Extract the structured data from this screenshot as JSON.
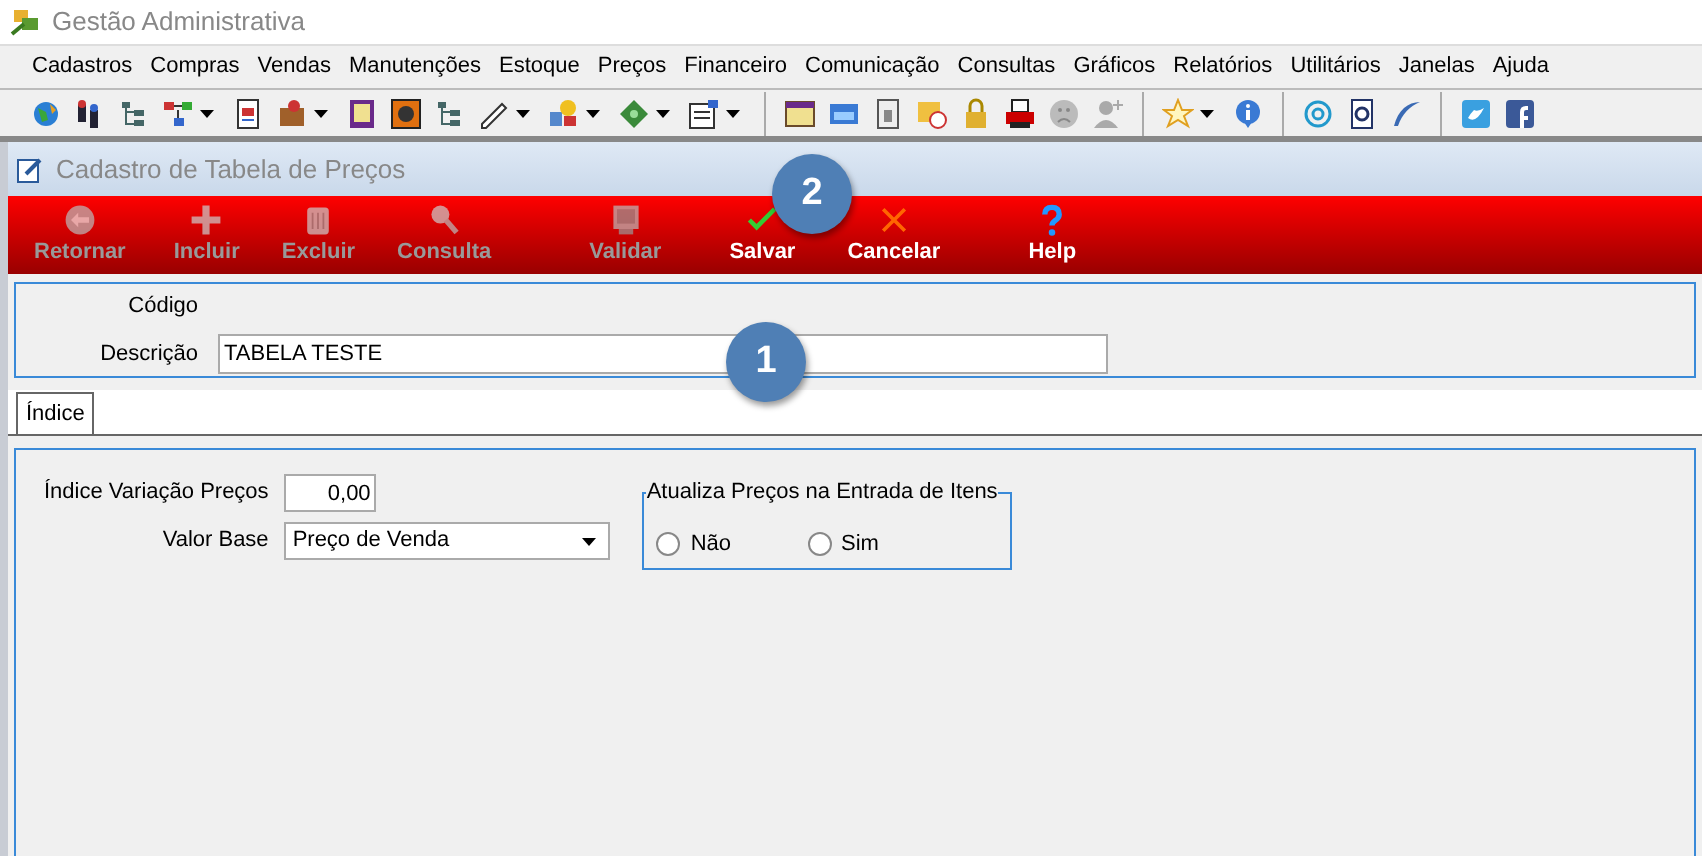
{
  "app_title": "Gestão Administrativa",
  "menu": [
    "Cadastros",
    "Compras",
    "Vendas",
    "Manutenções",
    "Estoque",
    "Preços",
    "Financeiro",
    "Comunicação",
    "Consultas",
    "Gráficos",
    "Relatórios",
    "Utilitários",
    "Janelas",
    "Ajuda"
  ],
  "toolbar": [
    {
      "kind": "button",
      "has_menu": false
    },
    {
      "kind": "button",
      "has_menu": false
    },
    {
      "kind": "button",
      "has_menu": false
    },
    {
      "kind": "button",
      "has_menu": true
    },
    {
      "kind": "button",
      "has_menu": false
    },
    {
      "kind": "button",
      "has_menu": true
    },
    {
      "kind": "button",
      "has_menu": false
    },
    {
      "kind": "button",
      "has_menu": false
    },
    {
      "kind": "button",
      "has_menu": false
    },
    {
      "kind": "button",
      "has_menu": true
    },
    {
      "kind": "button",
      "has_menu": true
    },
    {
      "kind": "button",
      "has_menu": true
    },
    {
      "kind": "button",
      "has_menu": true
    },
    {
      "kind": "separator"
    },
    {
      "kind": "button",
      "has_menu": false
    },
    {
      "kind": "button",
      "has_menu": false
    },
    {
      "kind": "button",
      "has_menu": false
    },
    {
      "kind": "button",
      "has_menu": false
    },
    {
      "kind": "button",
      "has_menu": false
    },
    {
      "kind": "button",
      "has_menu": false
    },
    {
      "kind": "button",
      "has_menu": false
    },
    {
      "kind": "button",
      "has_menu": false
    },
    {
      "kind": "separator"
    },
    {
      "kind": "button",
      "has_menu": true
    },
    {
      "kind": "button",
      "has_menu": false
    },
    {
      "kind": "separator"
    },
    {
      "kind": "button",
      "has_menu": false
    },
    {
      "kind": "button",
      "has_menu": false
    },
    {
      "kind": "button",
      "has_menu": false
    },
    {
      "kind": "separator"
    },
    {
      "kind": "button",
      "has_menu": false
    },
    {
      "kind": "button",
      "has_menu": false
    }
  ],
  "window": {
    "title": "Cadastro de Tabela de Preços"
  },
  "actions": [
    {
      "label": "Retornar",
      "disabled": true
    },
    {
      "label": "Incluir",
      "disabled": true
    },
    {
      "label": "Excluir",
      "disabled": true
    },
    {
      "label": "Consulta",
      "disabled": true
    },
    {
      "label": "Validar",
      "disabled": true
    },
    {
      "label": "Salvar",
      "disabled": false
    },
    {
      "label": "Cancelar",
      "disabled": false
    },
    {
      "label": "Help",
      "disabled": false
    }
  ],
  "header_form": {
    "code_label": "Código",
    "description_label": "Descrição",
    "description_value": "TABELA TESTE"
  },
  "tabs": [
    {
      "label": "Índice",
      "selected": true
    }
  ],
  "index_form": {
    "index_label": "Índice Variação Preços",
    "index_value": "0,00",
    "base_label": "Valor Base",
    "base_value": "Preço de Venda",
    "group_title": "Atualiza Preços na Entrada de Itens",
    "options": [
      {
        "label": "Não",
        "selected": false
      },
      {
        "label": "Sim",
        "selected": false
      }
    ]
  },
  "callouts": [
    {
      "label": "2"
    },
    {
      "label": "1"
    }
  ]
}
